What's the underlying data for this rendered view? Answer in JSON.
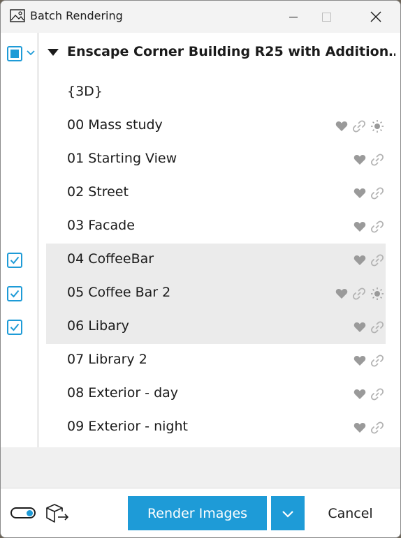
{
  "window": {
    "title": "Batch Rendering"
  },
  "tree": {
    "project_title": "Enscape Corner Building R25 with Addition…",
    "root_checkbox_state": "partial",
    "items": [
      {
        "label": "{3D}",
        "checked": false,
        "selected": false,
        "icons": []
      },
      {
        "label": "00 Mass study",
        "checked": false,
        "selected": false,
        "icons": [
          "heart-icon",
          "link-icon",
          "sun-icon"
        ]
      },
      {
        "label": "01 Starting View",
        "checked": false,
        "selected": false,
        "icons": [
          "heart-icon",
          "link-icon"
        ]
      },
      {
        "label": "02 Street",
        "checked": false,
        "selected": false,
        "icons": [
          "heart-icon",
          "link-icon"
        ]
      },
      {
        "label": "03 Facade",
        "checked": false,
        "selected": false,
        "icons": [
          "heart-icon",
          "link-icon"
        ]
      },
      {
        "label": "04 CoffeeBar",
        "checked": true,
        "selected": true,
        "icons": [
          "heart-icon",
          "link-icon"
        ]
      },
      {
        "label": "05 Coffee Bar 2",
        "checked": true,
        "selected": true,
        "icons": [
          "heart-icon",
          "link-icon",
          "sun-icon"
        ]
      },
      {
        "label": "06 Libary",
        "checked": true,
        "selected": true,
        "icons": [
          "heart-icon",
          "link-icon"
        ]
      },
      {
        "label": "07 Library 2",
        "checked": false,
        "selected": false,
        "icons": [
          "heart-icon",
          "link-icon"
        ]
      },
      {
        "label": "08 Exterior - day",
        "checked": false,
        "selected": false,
        "icons": [
          "heart-icon",
          "link-icon"
        ]
      },
      {
        "label": "09 Exterior - night",
        "checked": false,
        "selected": false,
        "icons": [
          "heart-icon",
          "link-icon"
        ]
      }
    ]
  },
  "footer": {
    "toggle_on": true,
    "render_label": "Render Images",
    "cancel_label": "Cancel"
  },
  "colors": {
    "accent": "#1e9bd7",
    "selected_row": "#ebebeb",
    "icon_gray": "#9a9a9a"
  }
}
